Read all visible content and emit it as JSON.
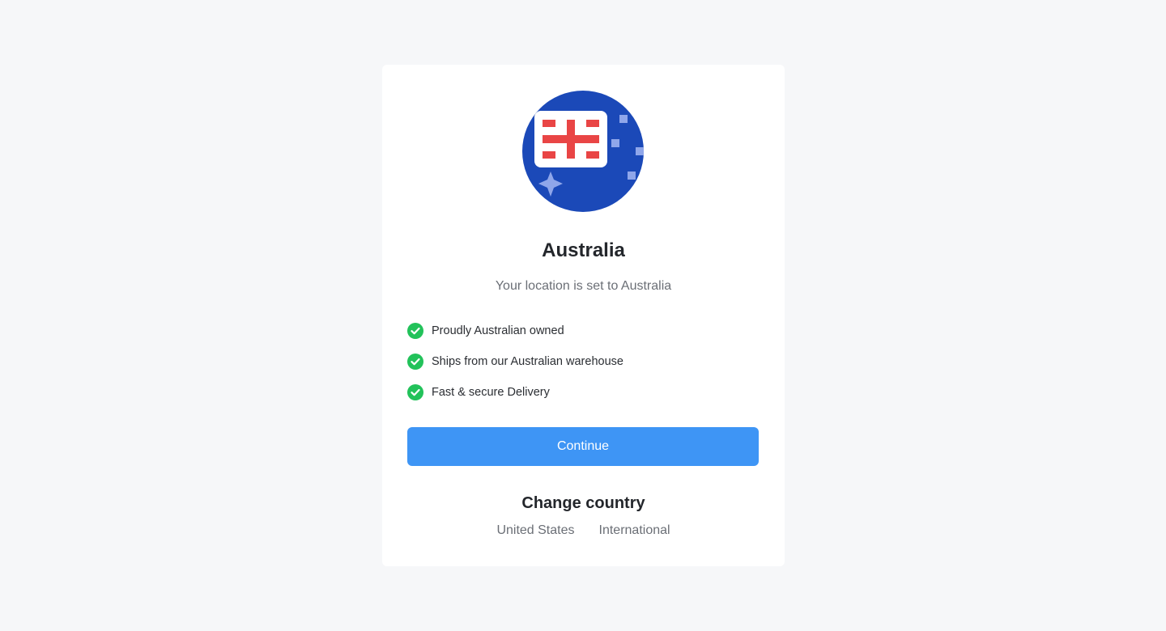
{
  "card": {
    "flag_icon": "australia-flag-icon",
    "title": "Australia",
    "subtitle": "Your location is set to Australia",
    "features": [
      {
        "icon": "check-circle-icon",
        "label": "Proudly Australian owned"
      },
      {
        "icon": "check-circle-icon",
        "label": "Ships from our Australian warehouse"
      },
      {
        "icon": "check-circle-icon",
        "label": "Fast & secure Delivery"
      }
    ],
    "continue_label": "Continue",
    "change_country": {
      "title": "Change country",
      "options": [
        "United States",
        "International"
      ]
    }
  },
  "colors": {
    "background": "#f6f7f9",
    "card": "#ffffff",
    "flag_blue": "#1b49b8",
    "flag_red": "#e94545",
    "check_green": "#22c25a",
    "button_blue": "#3e95f5"
  }
}
